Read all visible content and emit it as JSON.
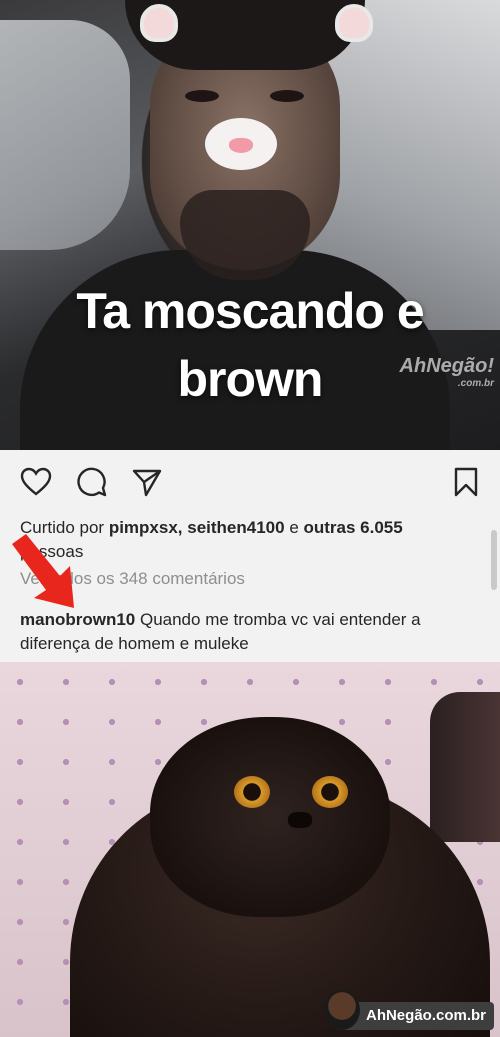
{
  "post1": {
    "caption_line1": "Ta moscando e",
    "caption_line2": "brown",
    "watermark": "AhNegão!",
    "watermark_sub": ".com.br"
  },
  "actions": {
    "icons": [
      "heart-icon",
      "comment-icon",
      "share-icon",
      "bookmark-icon"
    ]
  },
  "likes": {
    "prefix": "Curtido por ",
    "users": "pimpxsx, seithen4100",
    "connector": " e ",
    "others": "outras 6.055",
    "suffix": "pessoas"
  },
  "view_all": "Ver todos os 348 comentários",
  "comment": {
    "username": "manobrown10",
    "text": " Quando me tromba vc vai entender a diferença de homem e muleke"
  },
  "post2": {
    "watermark": "AhNegão.com.br"
  },
  "colors": {
    "arrow": "#e8261d",
    "text": "#262626",
    "muted": "#8e8e8e"
  }
}
